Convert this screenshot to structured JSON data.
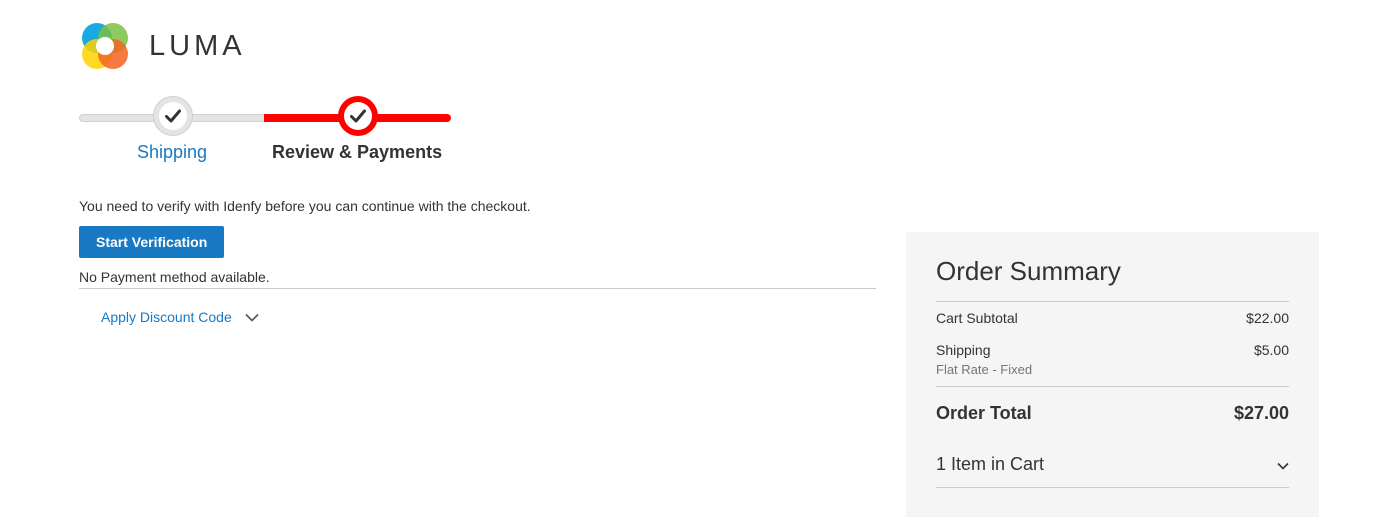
{
  "header": {
    "logo_text": "LUMA",
    "logo_icon": "luma-logo-icon"
  },
  "progress": {
    "steps": [
      {
        "label": "Shipping",
        "state": "complete"
      },
      {
        "label": "Review & Payments",
        "state": "active"
      }
    ]
  },
  "main": {
    "verify_message": "You need to verify with Idenfy before you can continue with the checkout.",
    "start_verification_label": "Start Verification",
    "no_payment_message": "No Payment method available.",
    "discount_label": "Apply Discount Code"
  },
  "summary": {
    "title": "Order Summary",
    "cart_subtotal_label": "Cart Subtotal",
    "cart_subtotal_value": "$22.00",
    "shipping_label": "Shipping",
    "shipping_value": "$5.00",
    "shipping_method": "Flat Rate - Fixed",
    "order_total_label": "Order Total",
    "order_total_value": "$27.00",
    "items_in_cart": "1 Item in Cart"
  },
  "colors": {
    "accent_link": "#1979c3",
    "progress_active": "#ff0000",
    "summary_bg": "#f5f5f5"
  }
}
